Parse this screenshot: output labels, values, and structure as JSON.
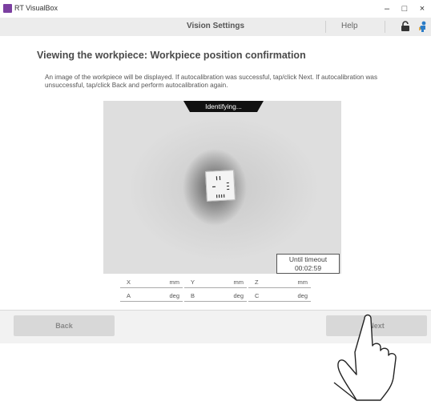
{
  "window": {
    "app_title": "RT VisualBox",
    "controls": [
      "–",
      "□",
      "×"
    ]
  },
  "header": {
    "title": "Vision Settings",
    "help_label": "Help"
  },
  "page": {
    "heading": "Viewing the workpiece: Workpiece position confirmation",
    "description": "An image of the workpiece will be displayed. If autocalibration was successful, tap/click Next. If autocalibration was unsuccessful, tap/click Back and perform autocalibration again."
  },
  "camera": {
    "status": "Identifying...",
    "timeout_label": "Until timeout",
    "timeout_value": "00:02:59"
  },
  "coordinates": {
    "row1": [
      {
        "label": "X",
        "unit": "mm"
      },
      {
        "label": "Y",
        "unit": "mm"
      },
      {
        "label": "Z",
        "unit": "mm"
      }
    ],
    "row2": [
      {
        "label": "A",
        "unit": "deg"
      },
      {
        "label": "B",
        "unit": "deg"
      },
      {
        "label": "C",
        "unit": "deg"
      }
    ]
  },
  "footer": {
    "back_label": "Back",
    "next_label": "Next"
  },
  "icons": {
    "app": "app-icon",
    "lock": "lock-icon",
    "user": "user-icon",
    "hand": "hand-pointer-icon"
  }
}
